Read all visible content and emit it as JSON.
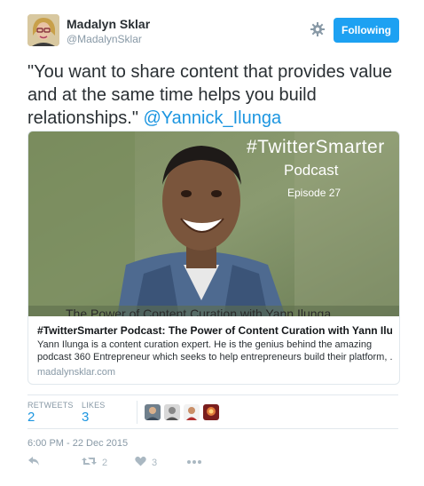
{
  "author": {
    "name": "Madalyn Sklar",
    "handle": "@MadalynSklar"
  },
  "header": {
    "follow_label": "Following",
    "settings_icon": "gear-icon",
    "accent_color": "#1da1f2"
  },
  "tweet": {
    "text": "\"You want to share content that provides value and at the same time helps you build relationships.\" ",
    "mention": "@Yannick_Ilunga"
  },
  "card": {
    "image_overlay": {
      "title_line1": "#TwitterSmarter",
      "title_line2": "Podcast",
      "episode": "Episode 27",
      "caption": "The Power of Content Curation with Yann Ilunga"
    },
    "title": "#TwitterSmarter Podcast: The Power of Content Curation with Yann Ilunga [Epis...",
    "description_line1": "Yann Ilunga is a content curation expert. He is the genius behind the amazing",
    "description_line2": "podcast 360 Entrepreneur which seeks to help entrepreneurs build their platform, ...",
    "domain": "madalynsklar.com"
  },
  "stats": {
    "retweets_label": "RETWEETS",
    "retweets_value": "2",
    "likes_label": "LIKES",
    "likes_value": "3"
  },
  "timestamp": "6:00 PM - 22 Dec 2015",
  "actions": {
    "reply_icon": "reply-icon",
    "retweet_icon": "retweet-icon",
    "retweet_count": "2",
    "like_icon": "heart-icon",
    "like_count": "3",
    "more_icon": "more-icon"
  }
}
